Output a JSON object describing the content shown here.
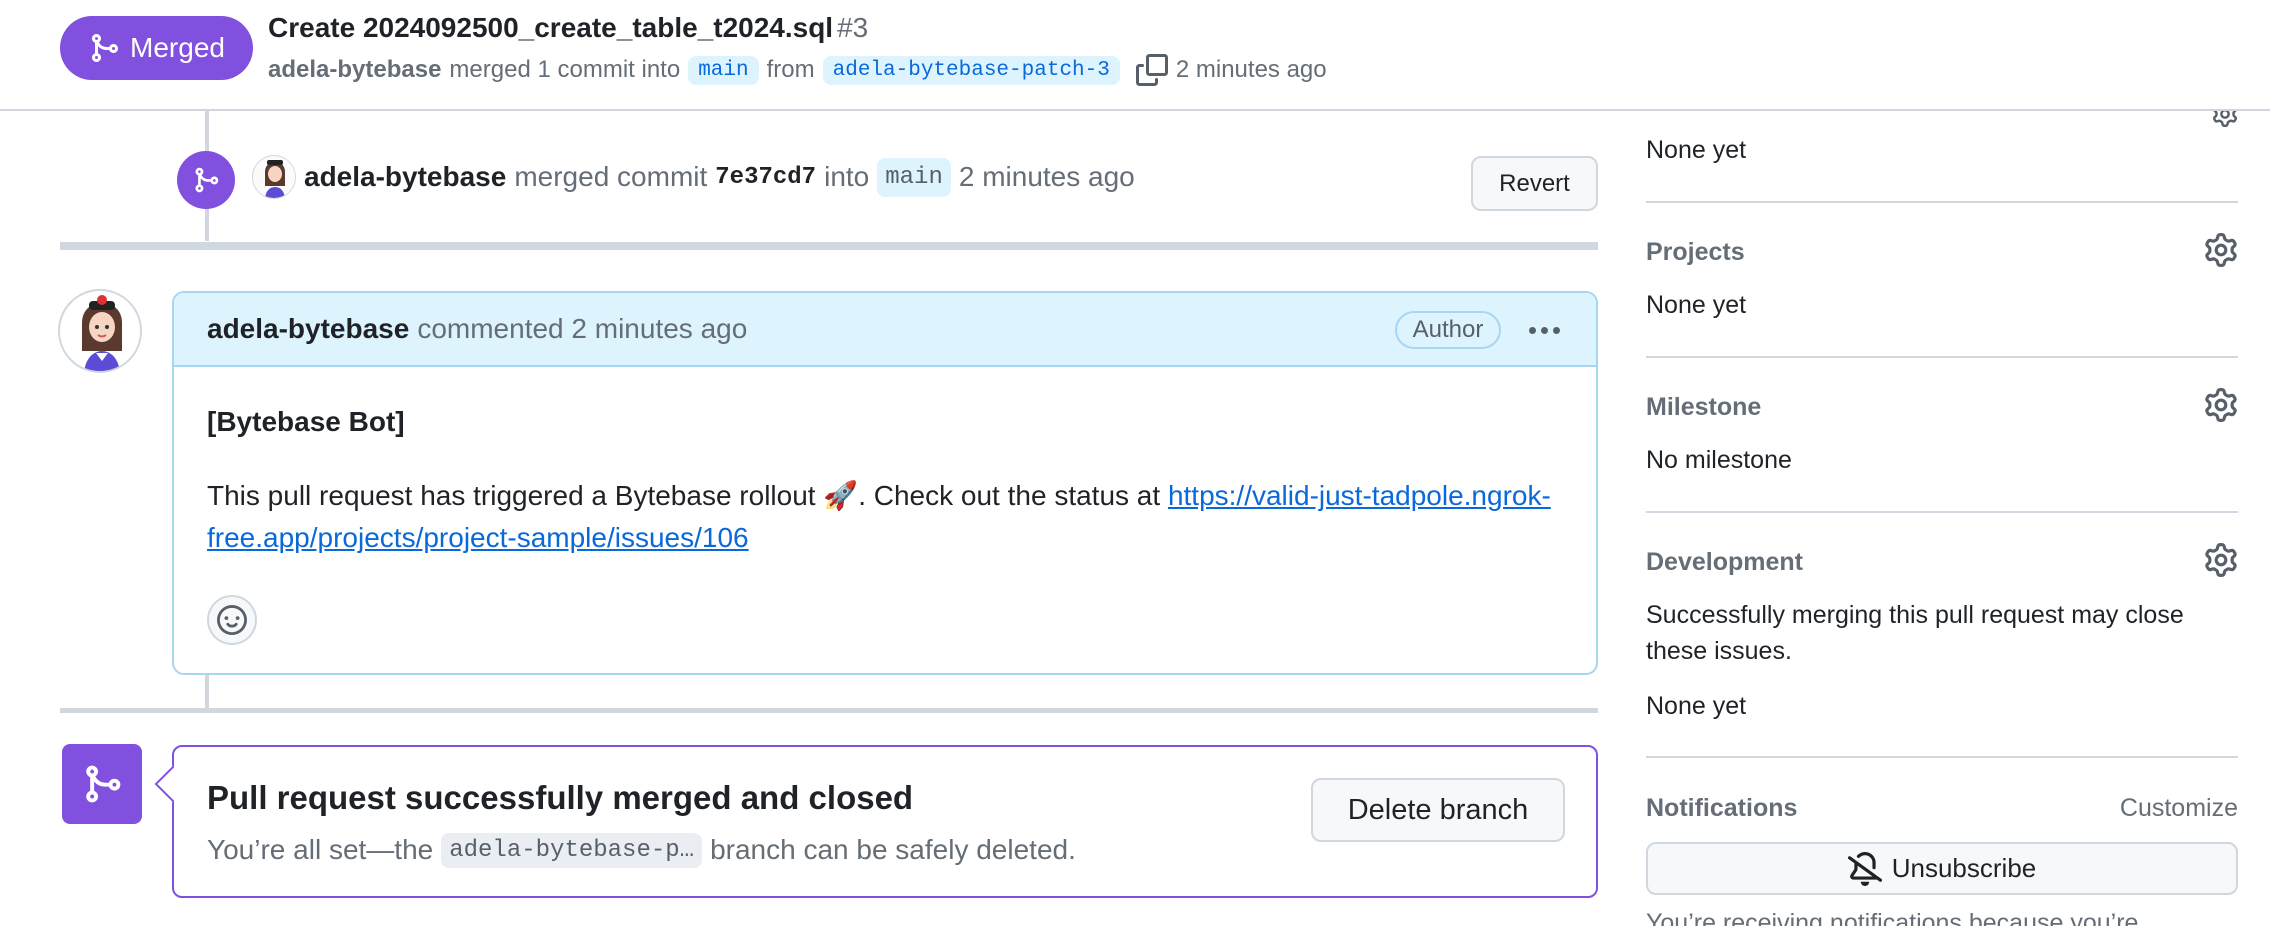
{
  "header": {
    "state": "Merged",
    "title": "Create 2024092500_create_table_t2024.sql",
    "number": "#3",
    "author": "adela-bytebase",
    "merged_text": "merged 1 commit into",
    "base_branch": "main",
    "from_text": "from",
    "head_branch": "adela-bytebase-patch-3",
    "time": "2 minutes ago"
  },
  "merge_event": {
    "user": "adela-bytebase",
    "action": "merged commit",
    "sha": "7e37cd7",
    "into_text": "into",
    "branch": "main",
    "time": "2 minutes ago",
    "revert_label": "Revert"
  },
  "comment": {
    "user": "adela-bytebase",
    "action": "commented",
    "time": "2 minutes ago",
    "author_badge": "Author",
    "bot_title": "[Bytebase Bot]",
    "body_text": "This pull request has triggered a Bytebase rollout 🚀. Check out the status at",
    "link": "https://valid-just-tadpole.ngrok-free.app/projects/project-sample/issues/106"
  },
  "merged_box": {
    "title": "Pull request successfully merged and closed",
    "subtitle_before": "You’re all set—the",
    "branch": "adela-bytebase-p…",
    "subtitle_after": "branch can be safely deleted.",
    "delete_label": "Delete branch"
  },
  "sidebar": {
    "top_value": "None yet",
    "projects": {
      "label": "Projects",
      "value": "None yet"
    },
    "milestone": {
      "label": "Milestone",
      "value": "No milestone"
    },
    "development": {
      "label": "Development",
      "description": "Successfully merging this pull request may close these issues.",
      "value": "None yet"
    },
    "notifications": {
      "label": "Notifications",
      "customize": "Customize",
      "unsubscribe": "Unsubscribe",
      "note": "You’re receiving notifications because you’re"
    }
  },
  "colors": {
    "merged_purple": "#8250df",
    "link_blue": "#0969da",
    "comment_header_bg": "#ddf4ff",
    "border": "#d0d7de"
  },
  "icons": [
    "git-merge-icon",
    "copy-icon",
    "gear-icon",
    "smiley-icon",
    "bell-slash-icon",
    "kebab-icon"
  ]
}
